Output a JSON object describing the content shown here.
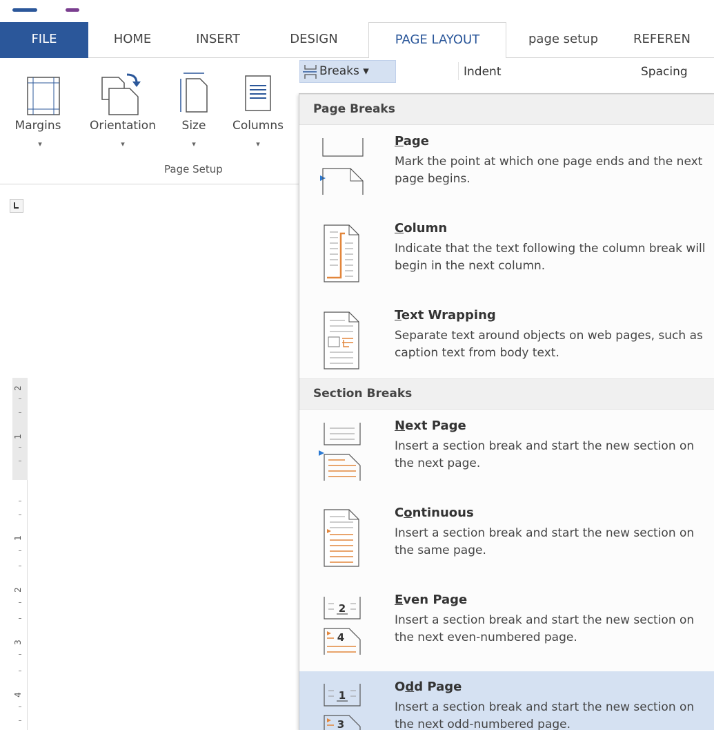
{
  "colors": {
    "accent": "#2b579a",
    "highlight": "#d5e1f2",
    "icon_orange": "#e2863b",
    "marker_blue": "#2b79d2"
  },
  "tabs": [
    {
      "label": "FILE"
    },
    {
      "label": "HOME"
    },
    {
      "label": "INSERT"
    },
    {
      "label": "DESIGN"
    },
    {
      "label": "PAGE LAYOUT"
    },
    {
      "label": "page setup"
    },
    {
      "label": "REFEREN"
    }
  ],
  "ribbon": {
    "margins_label": "Margins",
    "orientation_label": "Orientation",
    "size_label": "Size",
    "columns_label": "Columns",
    "breaks_label": "Breaks",
    "indent_label": "Indent",
    "spacing_label": "Spacing",
    "group_label": "Page Setup"
  },
  "ruler": {
    "numbers": [
      "2",
      "1",
      "1",
      "2",
      "3",
      "4"
    ]
  },
  "menu": {
    "page_breaks_header": "Page Breaks",
    "section_breaks_header": "Section Breaks",
    "page": {
      "key": "P",
      "title_rest": "age",
      "desc": "Mark the point at which one page ends and the next page begins."
    },
    "column": {
      "key": "C",
      "title_rest": "olumn",
      "desc": "Indicate that the text following the column break will begin in the next column."
    },
    "text_wrapping": {
      "key": "T",
      "title_rest": "ext Wrapping",
      "desc": "Separate text around objects on web pages, such as caption text from body text."
    },
    "next_page": {
      "key": "N",
      "title_rest": "ext Page",
      "desc": "Insert a section break and start the new section on the next page."
    },
    "continuous": {
      "title_pre": "C",
      "key": "o",
      "title_rest": "ntinuous",
      "desc": "Insert a section break and start the new section on the same page."
    },
    "even_page": {
      "key": "E",
      "title_rest": "ven Page",
      "desc": "Insert a section break and start the new section on the next even-numbered page.",
      "icon_top_number": "2",
      "icon_bottom_number": "4"
    },
    "odd_page": {
      "title_pre": "O",
      "key": "d",
      "title_rest": "d Page",
      "desc": "Insert a section break and start the new section on the next odd-numbered page.",
      "icon_top_number": "1",
      "icon_bottom_number": "3"
    }
  }
}
